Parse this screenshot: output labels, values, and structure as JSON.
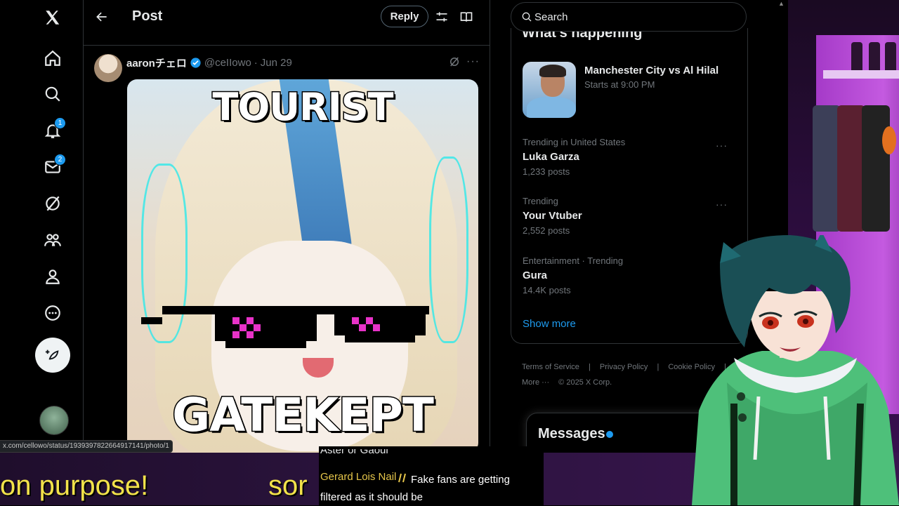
{
  "nav": {
    "notifications_badge": "1",
    "messages_badge": "2"
  },
  "post": {
    "header_title": "Post",
    "reply_label": "Reply",
    "author_name": "aaronチェロ",
    "author_handle": "@ceIIowo",
    "date": "Jun 29",
    "meta_sep": "·",
    "image_caption_top": "TOURIST",
    "image_caption_bottom": "GATEKEPT"
  },
  "status_url": "x.com/cellowo/status/1939397822664917141/photo/1",
  "sidebar": {
    "search_placeholder": "Search",
    "trends_title": "What's happening",
    "event": {
      "title": "Manchester City vs Al Hilal",
      "subtitle": "Starts at 9:00 PM"
    },
    "trends": [
      {
        "context": "Trending in United States",
        "name": "Luka Garza",
        "count": "1,233 posts"
      },
      {
        "context": "Trending",
        "name": "Your Vtuber",
        "count": "2,552 posts"
      },
      {
        "context": "Entertainment · Trending",
        "name": "Gura",
        "count": "14.4K posts"
      }
    ],
    "show_more": "Show more",
    "footer": {
      "terms": "Terms of Service",
      "privacy": "Privacy Policy",
      "cookie": "Cookie Policy",
      "sep": "|",
      "more": "More ···",
      "copyright": "© 2025 X Corp."
    },
    "messages_title": "Messages"
  },
  "chat": {
    "ticker_1": "on purpose!",
    "ticker_2": "sor",
    "previous_text": "Aster or Gaoul",
    "user": "Gerard Lois Nail",
    "message": "Fake fans are getting filtered as it should be"
  },
  "colors": {
    "accent": "#1d9bf0",
    "ticker": "#f2e24a",
    "chat_user": "#e6c64a"
  }
}
